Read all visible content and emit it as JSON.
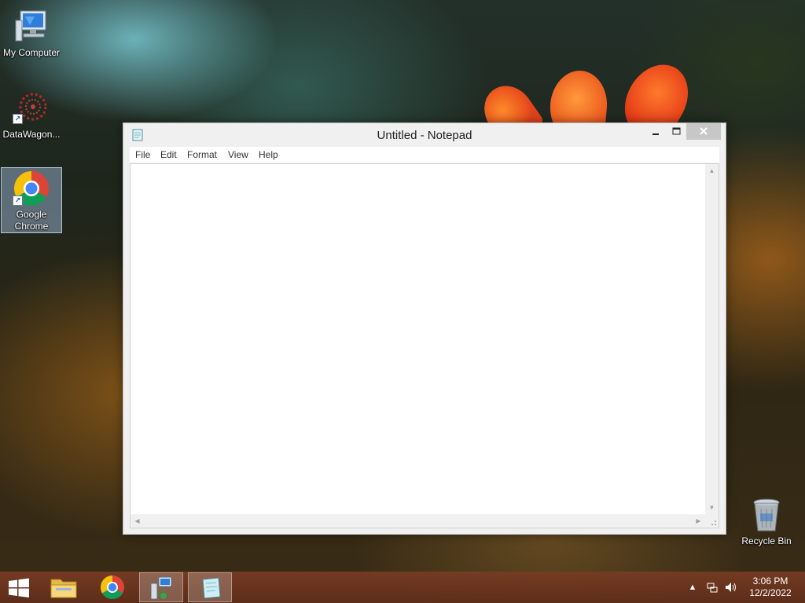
{
  "desktop": {
    "icons": [
      {
        "label": "My Computer",
        "icon": "computer-icon"
      },
      {
        "label": "DataWagon...",
        "icon": "datawagon-icon"
      },
      {
        "label": "Google Chrome",
        "icon": "chrome-icon"
      }
    ],
    "recycle_bin": {
      "label": "Recycle Bin",
      "icon": "recycle-bin-icon"
    }
  },
  "window": {
    "title": "Untitled - Notepad",
    "controls": {
      "minimize": "minimize-icon",
      "maximize": "maximize-icon",
      "close": "close-icon"
    },
    "menu": [
      "File",
      "Edit",
      "Format",
      "View",
      "Help"
    ],
    "editor_value": ""
  },
  "taskbar": {
    "items": [
      {
        "name": "start-button",
        "icon": "windows-logo-icon"
      },
      {
        "name": "file-explorer",
        "icon": "folder-icon"
      },
      {
        "name": "google-chrome",
        "icon": "chrome-icon"
      },
      {
        "name": "network-config",
        "icon": "network-computer-icon"
      },
      {
        "name": "notepad",
        "icon": "notepad-icon"
      }
    ],
    "tray": {
      "icons": [
        "show-hidden-icons",
        "network-icon",
        "volume-icon"
      ]
    },
    "clock": {
      "time": "3:06 PM",
      "date": "12/2/2022"
    }
  },
  "colors": {
    "taskbar": "#6e3620",
    "window_frame": "#f0f0f0",
    "close_button": "#c7c7c7",
    "selection": "#aac8eb"
  }
}
